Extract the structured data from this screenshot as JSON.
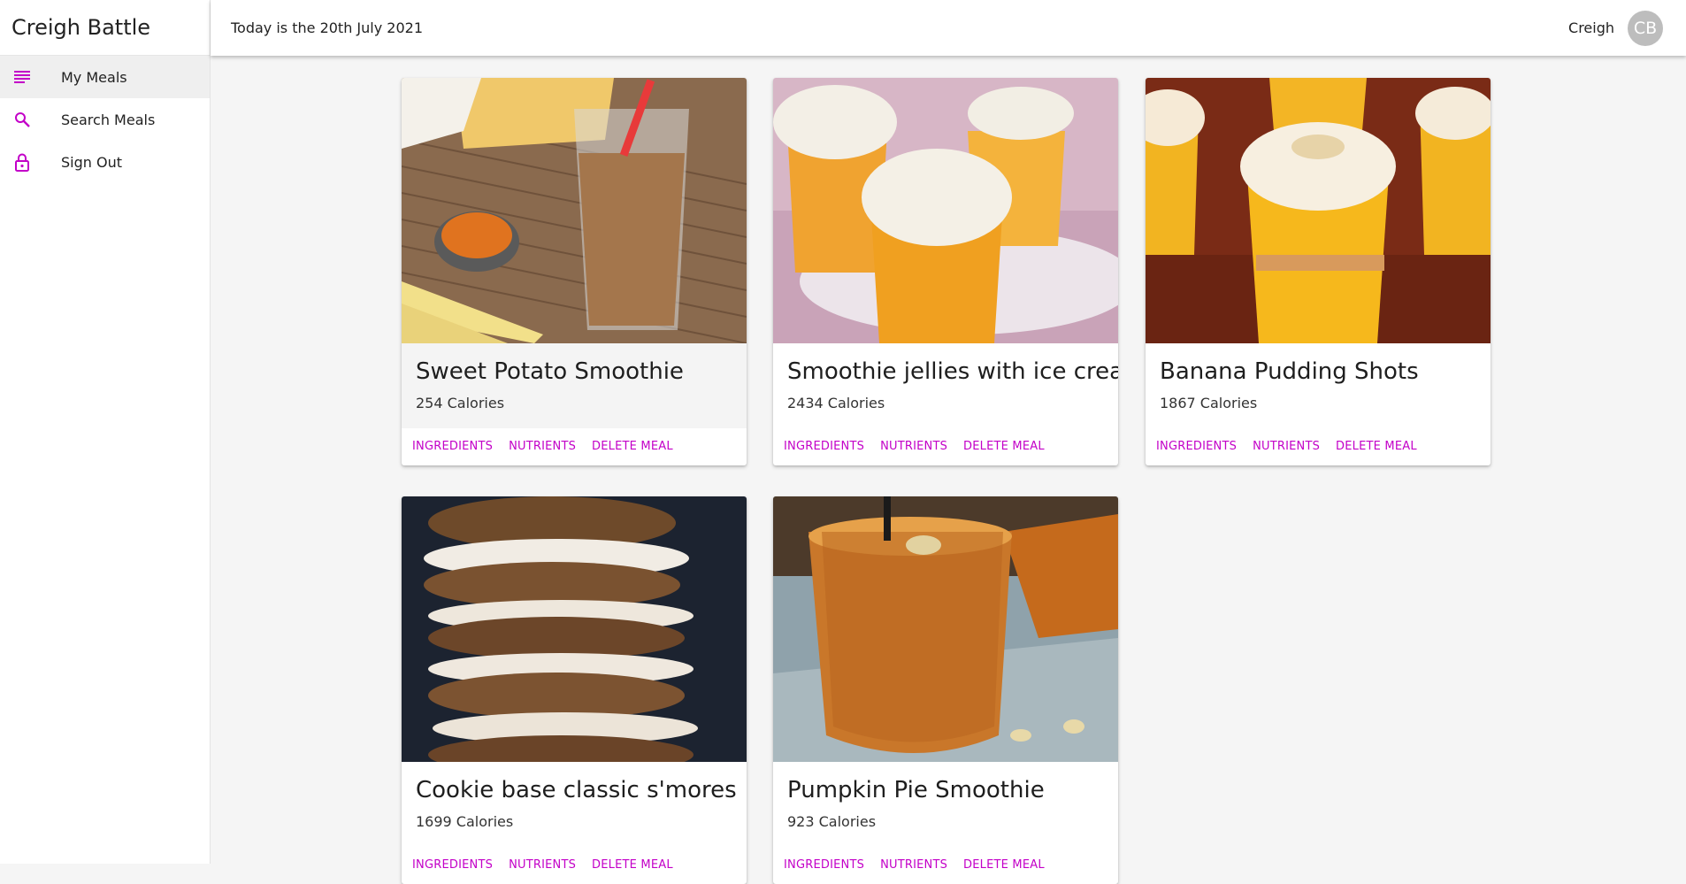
{
  "sidebar": {
    "brand": "Creigh Battle",
    "items": [
      {
        "label": "My Meals",
        "icon": "list-icon",
        "active": true
      },
      {
        "label": "Search Meals",
        "icon": "search-icon",
        "active": false
      },
      {
        "label": "Sign Out",
        "icon": "lock-icon",
        "active": false
      }
    ]
  },
  "header": {
    "date_text": "Today is the 20th July 2021",
    "user_name": "Creigh",
    "avatar_initials": "CB"
  },
  "accent_color": "#c300c8",
  "meals": [
    {
      "title": "Sweet Potato Smoothie",
      "calories": "254 Calories",
      "actions": [
        "INGREDIENTS",
        "NUTRIENTS",
        "DELETE MEAL"
      ]
    },
    {
      "title": "Smoothie jellies with ice cream",
      "calories": "2434 Calories",
      "actions": [
        "INGREDIENTS",
        "NUTRIENTS",
        "DELETE MEAL"
      ]
    },
    {
      "title": "Banana Pudding Shots",
      "calories": "1867 Calories",
      "actions": [
        "INGREDIENTS",
        "NUTRIENTS",
        "DELETE MEAL"
      ]
    },
    {
      "title": "Cookie base classic s'mores",
      "calories": "1699 Calories",
      "actions": [
        "INGREDIENTS",
        "NUTRIENTS",
        "DELETE MEAL"
      ]
    },
    {
      "title": "Pumpkin Pie Smoothie",
      "calories": "923 Calories",
      "actions": [
        "INGREDIENTS",
        "NUTRIENTS",
        "DELETE MEAL"
      ]
    }
  ]
}
